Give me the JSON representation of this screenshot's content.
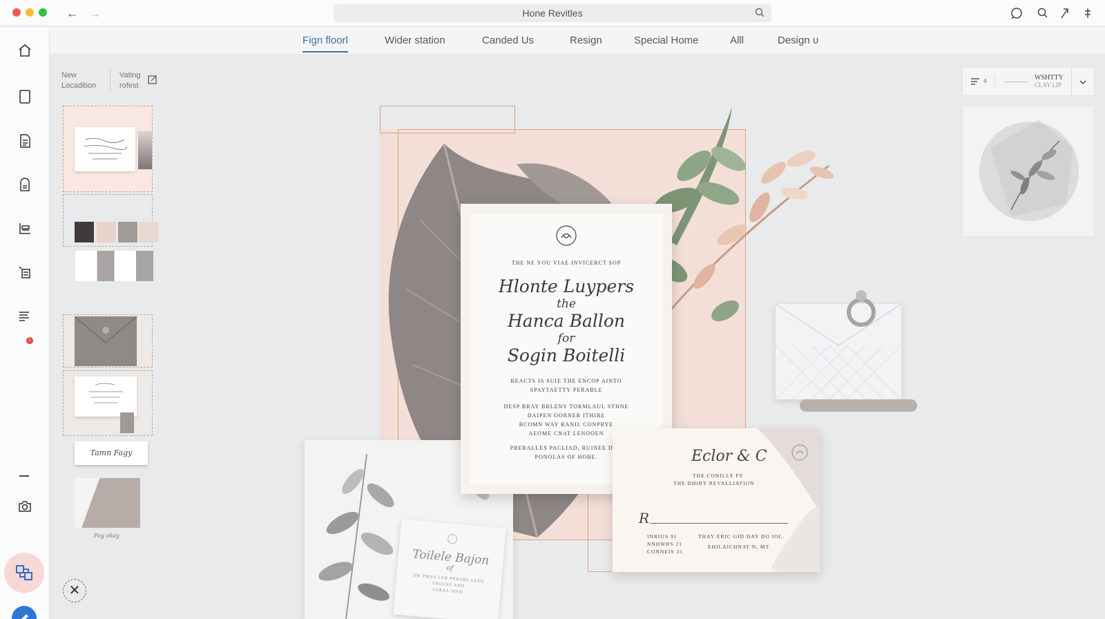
{
  "window": {
    "title": "Hone Revitles",
    "nav_back": "←",
    "nav_forward": "→"
  },
  "tabs": [
    {
      "label": "Fign floorl",
      "active": true
    },
    {
      "label": "Wider station",
      "active": false
    },
    {
      "label": "Canded Us",
      "active": false
    },
    {
      "label": "Resign",
      "active": false
    },
    {
      "label": "Special Home",
      "active": false
    },
    {
      "label": "Alll",
      "active": false
    },
    {
      "label": "Design υ",
      "active": false
    }
  ],
  "sidebar": {
    "notification_badge": "1",
    "icons": [
      "home-icon",
      "page-icon",
      "document-icon",
      "template-icon",
      "layers-icon",
      "list-icon",
      "text-icon",
      "camera-icon",
      "shapes-icon",
      "pen-icon"
    ]
  },
  "left_panel": {
    "new_location": "New Locadition",
    "voting": "Vating rofest",
    "thumb_caption_1": "Tamn Fagy",
    "thumb_caption_2": "Pog ohay",
    "swatches": [
      "#3f3b3a",
      "#e6d3c9",
      "#a19b98",
      "#e7d9cf"
    ]
  },
  "invitation": {
    "header": "THE NE YOU VIAE INVICERCT SOP",
    "name_1": "Hlonte Luypers",
    "the": "the",
    "name_2": "Hanca Ballon",
    "for": "for",
    "name_3": "Sogin Boitelli",
    "line_1": "REACTS IS SUIE THE ENCOP AINTO",
    "line_2": "SPAYTAETTY PERABLE",
    "line_3": "DESP BRAY BRLENY TORMLAUL STHNE",
    "line_4": "DAIPEN OORNER ITHIRE",
    "line_5": "BCOMN WAY RANIL CONPRYE",
    "line_6": "AEOME CNAT LENOOEN",
    "line_7": "PRERALLES PACLIAD, RUINEE DDA",
    "line_8": "PONOLAS OF HOBE."
  },
  "rsvp": {
    "title": "Eclor & C",
    "sub_1": "THE CONILLY FY",
    "sub_2": "THE DHIBY REVALLIATION",
    "field_label": "R",
    "left_1": "INRIUS 91",
    "left_2": "NNHWRS 21",
    "left_3": "CONNEIS 31",
    "right_1": "THAY ERIC GID DAY DO IOL.",
    "right_2": "EHILAICHNAT N, MT."
  },
  "place_card": {
    "name": "Toilele Bajon",
    "sub": "of",
    "line_1": "HR PMAS LER PRESHE LEED",
    "line_2": "TROUSE AND",
    "line_3": "LERAL IESD"
  },
  "right_panel": {
    "title": "WSHTTY",
    "subtitle": "CLAY LIP",
    "count": "4"
  }
}
